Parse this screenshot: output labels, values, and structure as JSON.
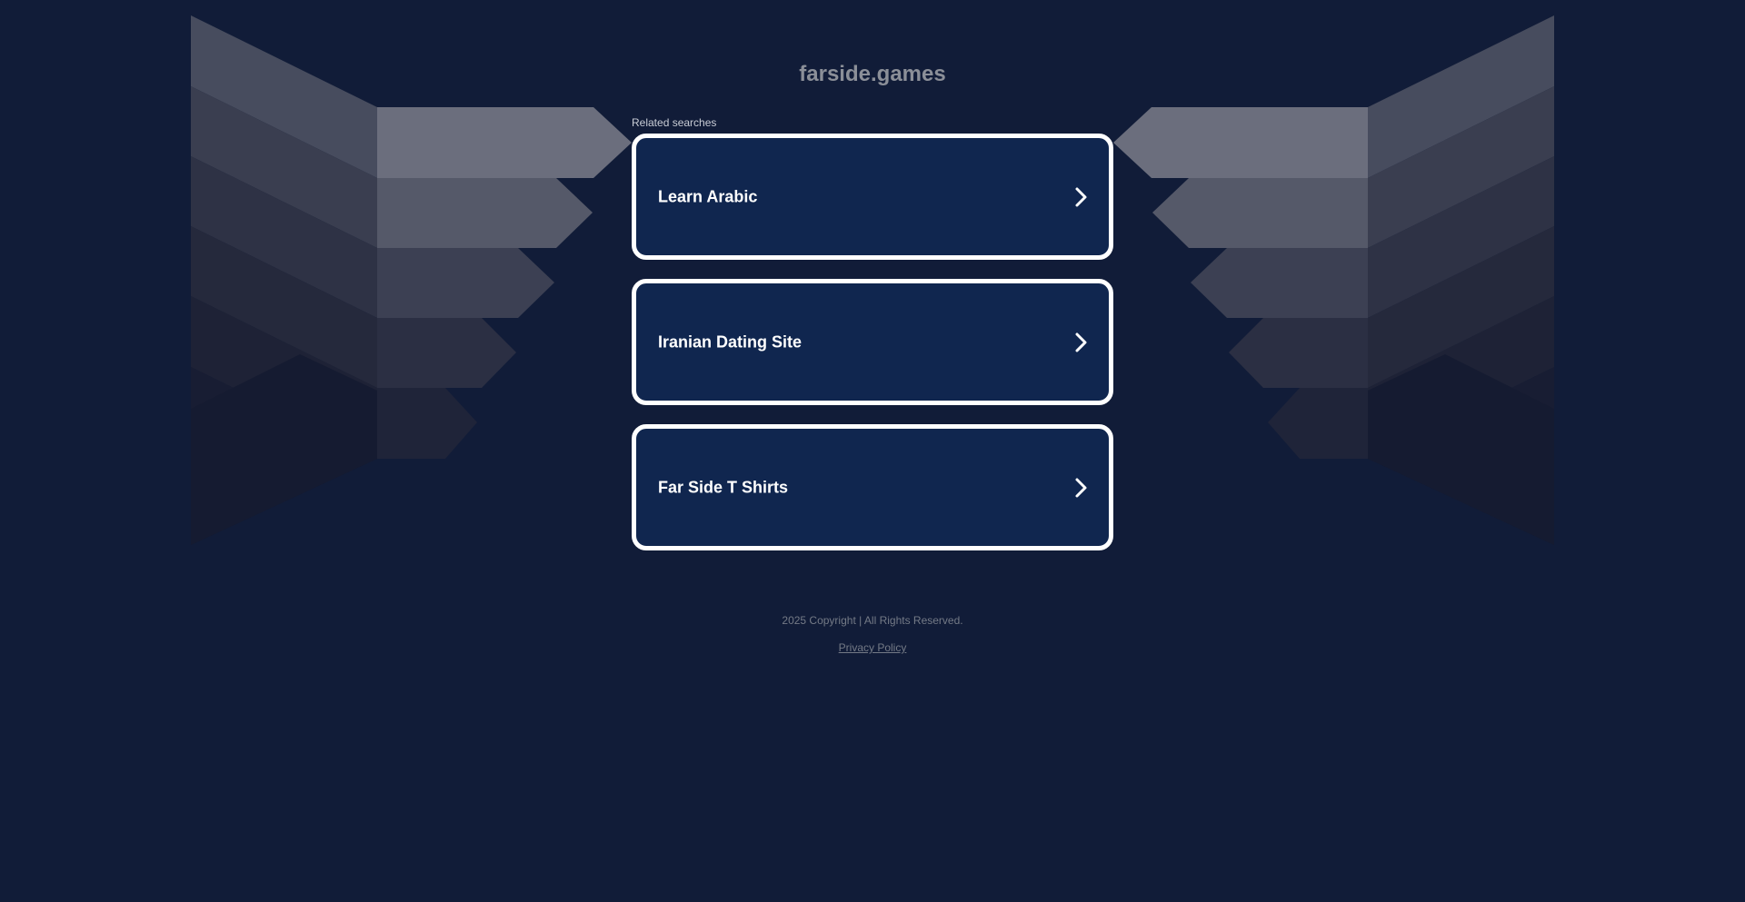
{
  "site": {
    "domain": "farside.games"
  },
  "related": {
    "label": "Related searches",
    "items": [
      {
        "label": "Learn Arabic"
      },
      {
        "label": "Iranian Dating Site"
      },
      {
        "label": "Far Side T Shirts"
      }
    ]
  },
  "footer": {
    "copyright": "2025 Copyright | All Rights Reserved.",
    "privacy_label": "Privacy Policy"
  },
  "colors": {
    "background": "#111c38",
    "card_background": "#10264f",
    "card_border": "#ffffff",
    "title_text": "#8b8f98",
    "footer_text": "#747a86"
  },
  "icons": {
    "card_arrow": "chevron-right-icon"
  }
}
